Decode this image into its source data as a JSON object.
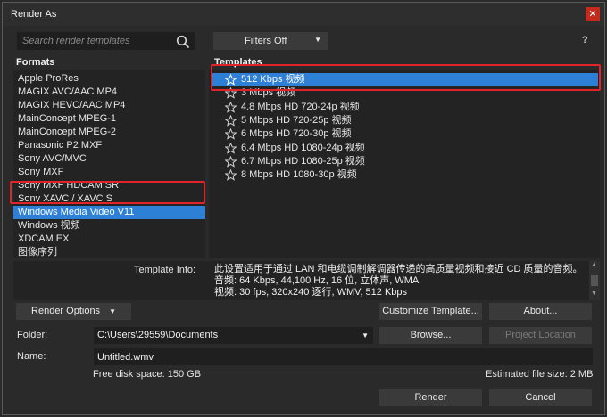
{
  "window": {
    "title": "Render As",
    "close_glyph": "✕"
  },
  "search": {
    "placeholder": "Search render templates",
    "icon": "search-icon"
  },
  "filters": {
    "label": "Filters Off",
    "help": "?"
  },
  "formats": {
    "header": "Formats",
    "items": [
      "Apple ProRes",
      "MAGIX AVC/AAC MP4",
      "MAGIX HEVC/AAC MP4",
      "MainConcept MPEG-1",
      "MainConcept MPEG-2",
      "Panasonic P2 MXF",
      "Sony AVC/MVC",
      "Sony MXF",
      "Sony MXF HDCAM SR",
      "Sony XAVC / XAVC S",
      "Windows Media Video V11",
      "Windows 视频",
      "XDCAM EX",
      "图像序列"
    ],
    "selected_index": 10
  },
  "templates": {
    "header": "Templates",
    "items": [
      "512 Kbps 视频",
      "3 Mbps 视频",
      "4.8 Mbps HD 720-24p 视频",
      "5 Mbps HD 720-25p 视频",
      "6 Mbps HD 720-30p 视频",
      "6.4 Mbps HD 1080-24p 视频",
      "6.7 Mbps HD 1080-25p 视频",
      "8 Mbps HD 1080-30p 视频"
    ],
    "selected_index": 0,
    "item_icon": "star-outline-icon"
  },
  "template_info": {
    "label": "Template Info:",
    "lines": [
      "此设置适用于通过 LAN 和电缆调制解调器传递的高质量视频和接近 CD 质量的音频。",
      "音频: 64 Kbps, 44,100 Hz, 16 位, 立体声, WMA",
      "视频: 30 fps, 320x240 逐行, WMV, 512 Kbps"
    ]
  },
  "buttons": {
    "render_options": "Render Options",
    "customize_template": "Customize Template...",
    "about": "About...",
    "browse": "Browse...",
    "project_location": "Project Location",
    "render": "Render",
    "cancel": "Cancel"
  },
  "folder": {
    "label": "Folder:",
    "value": "C:\\Users\\29559\\Documents"
  },
  "name": {
    "label": "Name:",
    "value": "Untitled.wmv"
  },
  "status": {
    "free_disk_space": "Free disk space: 150 GB",
    "estimated_file_size": "Estimated file size: 2 MB"
  },
  "colors": {
    "selection": "#2e7fd6",
    "highlight_box": "#e0242a",
    "close": "#c42b1c"
  }
}
